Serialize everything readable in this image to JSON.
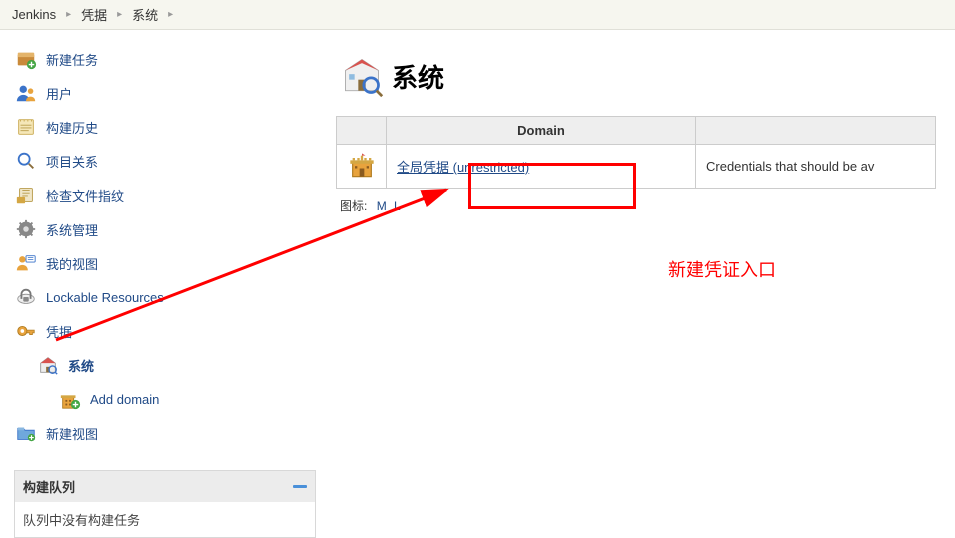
{
  "breadcrumb": [
    {
      "label": "Jenkins"
    },
    {
      "label": "凭据"
    },
    {
      "label": "系统"
    }
  ],
  "sidebar": {
    "items": [
      {
        "label": "新建任务",
        "icon": "new-item"
      },
      {
        "label": "用户",
        "icon": "user"
      },
      {
        "label": "构建历史",
        "icon": "history"
      },
      {
        "label": "项目关系",
        "icon": "search"
      },
      {
        "label": "检查文件指纹",
        "icon": "fingerprint"
      },
      {
        "label": "系统管理",
        "icon": "gear"
      },
      {
        "label": "我的视图",
        "icon": "my-view"
      },
      {
        "label": "Lockable Resources",
        "icon": "lock"
      },
      {
        "label": "凭据",
        "icon": "credentials"
      }
    ],
    "cred_children": [
      {
        "label": "系统",
        "icon": "system",
        "bold": true
      },
      {
        "label": "Add domain",
        "icon": "add-domain",
        "sub": true
      }
    ],
    "after_cred": [
      {
        "label": "新建视图",
        "icon": "folder"
      }
    ]
  },
  "queue": {
    "title": "构建队列",
    "empty": "队列中没有构建任务"
  },
  "page": {
    "title": "系统"
  },
  "table": {
    "headers": [
      "",
      "Domain",
      ""
    ],
    "rows": [
      {
        "link": "全局凭据 (unrestricted)",
        "desc": "Credentials that should be av"
      }
    ]
  },
  "icon_size": {
    "label_prefix": "图标:",
    "m": "M",
    "l": "L"
  },
  "annotation": {
    "text": "新建凭证入口"
  }
}
